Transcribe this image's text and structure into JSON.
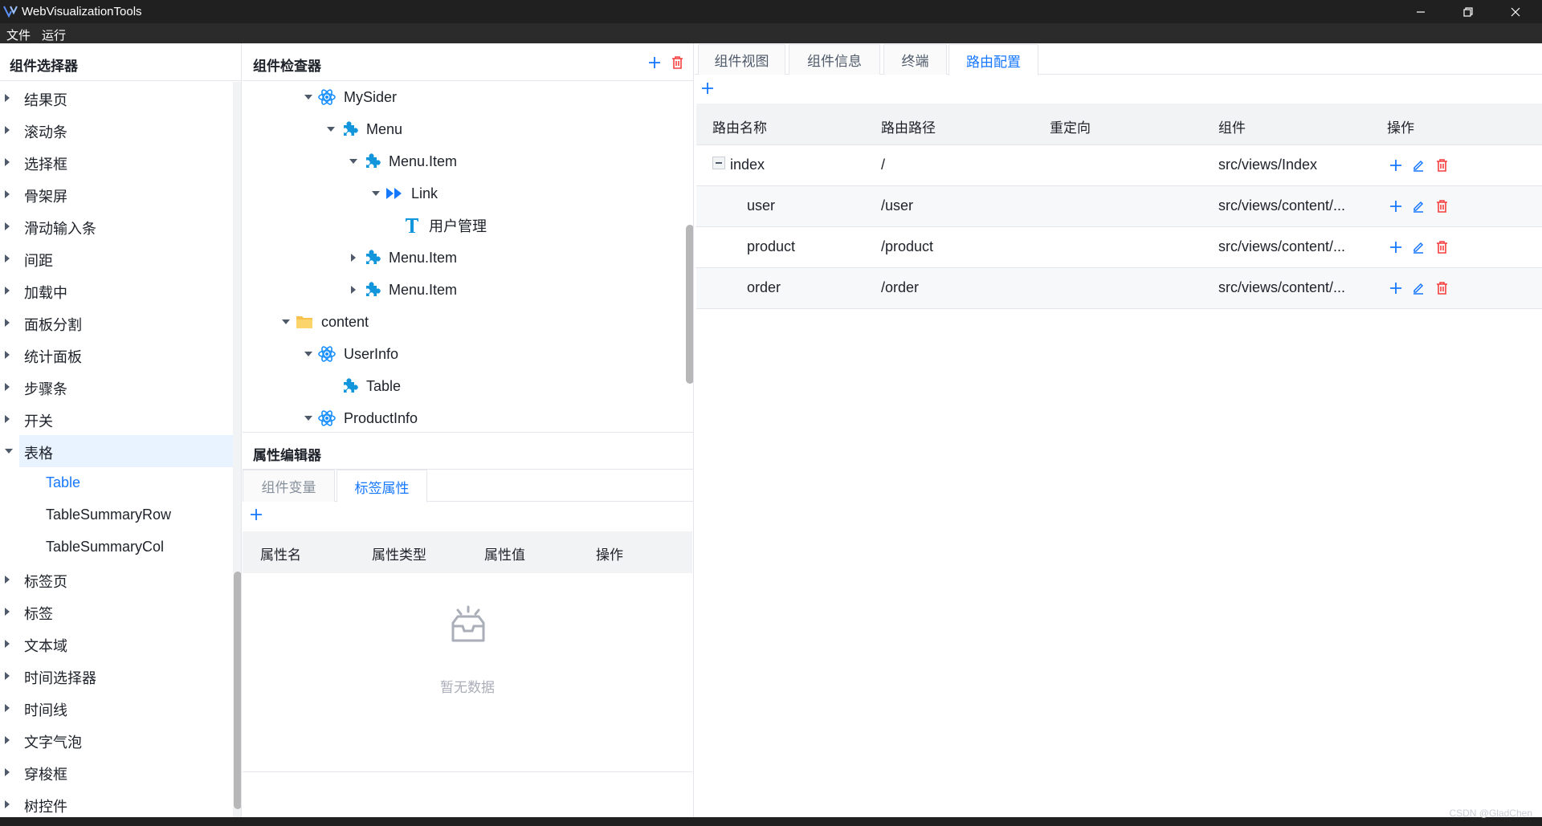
{
  "window": {
    "title": "WebVisualizationTools"
  },
  "menu": [
    "文件",
    "运行"
  ],
  "left": {
    "title": "组件选择器",
    "items": [
      {
        "label": "结果页",
        "state": "collapsed"
      },
      {
        "label": "滚动条",
        "state": "collapsed"
      },
      {
        "label": "选择框",
        "state": "collapsed"
      },
      {
        "label": "骨架屏",
        "state": "collapsed"
      },
      {
        "label": "滑动输入条",
        "state": "collapsed"
      },
      {
        "label": "间距",
        "state": "collapsed"
      },
      {
        "label": "加载中",
        "state": "collapsed"
      },
      {
        "label": "面板分割",
        "state": "collapsed"
      },
      {
        "label": "统计面板",
        "state": "collapsed"
      },
      {
        "label": "步骤条",
        "state": "collapsed"
      },
      {
        "label": "开关",
        "state": "collapsed"
      },
      {
        "label": "表格",
        "state": "expanded"
      },
      {
        "label": "Table",
        "state": "child-selected"
      },
      {
        "label": "TableSummaryRow",
        "state": "child"
      },
      {
        "label": "TableSummaryCol",
        "state": "child"
      },
      {
        "label": "标签页",
        "state": "collapsed"
      },
      {
        "label": "标签",
        "state": "collapsed"
      },
      {
        "label": "文本域",
        "state": "collapsed"
      },
      {
        "label": "时间选择器",
        "state": "collapsed"
      },
      {
        "label": "时间线",
        "state": "collapsed"
      },
      {
        "label": "文字气泡",
        "state": "collapsed"
      },
      {
        "label": "穿梭框",
        "state": "collapsed"
      },
      {
        "label": "树控件",
        "state": "collapsed"
      }
    ]
  },
  "inspector": {
    "title": "组件检查器",
    "nodes": [
      {
        "label": "MySider",
        "icon": "react-icon",
        "caret": "down"
      },
      {
        "label": "Menu",
        "icon": "puzzle-icon",
        "caret": "down"
      },
      {
        "label": "Menu.Item",
        "icon": "puzzle-icon",
        "caret": "down"
      },
      {
        "label": "Link",
        "icon": "forward-icon",
        "caret": "down"
      },
      {
        "label": "用户管理",
        "icon": "text-icon",
        "caret": "none"
      },
      {
        "label": "Menu.Item",
        "icon": "puzzle-icon",
        "caret": "right"
      },
      {
        "label": "Menu.Item",
        "icon": "puzzle-icon",
        "caret": "right"
      },
      {
        "label": "content",
        "icon": "folder-icon",
        "caret": "down"
      },
      {
        "label": "UserInfo",
        "icon": "react-icon",
        "caret": "down"
      },
      {
        "label": "Table",
        "icon": "puzzle-icon",
        "caret": "none"
      },
      {
        "label": "ProductInfo",
        "icon": "react-icon",
        "caret": "down"
      }
    ]
  },
  "props": {
    "title": "属性编辑器",
    "tabs": [
      "组件变量",
      "标签属性"
    ],
    "columns": [
      "属性名",
      "属性类型",
      "属性值",
      "操作"
    ],
    "empty_text": "暂无数据"
  },
  "right": {
    "tabs": [
      "组件视图",
      "组件信息",
      "终端",
      "路由配置"
    ],
    "columns": [
      "路由名称",
      "路由路径",
      "重定向",
      "组件",
      "操作"
    ],
    "rows": [
      {
        "name": "index",
        "path": "/",
        "redirect": "",
        "component": "src/views/Index"
      },
      {
        "name": "user",
        "path": "/user",
        "redirect": "",
        "component": "src/views/content/..."
      },
      {
        "name": "product",
        "path": "/product",
        "redirect": "",
        "component": "src/views/content/..."
      },
      {
        "name": "order",
        "path": "/order",
        "redirect": "",
        "component": "src/views/content/..."
      }
    ]
  },
  "watermark": "CSDN @GladChen",
  "colors": {
    "accent": "#1677ff",
    "danger": "#f53f3f",
    "titlebar": "#202020",
    "menubar": "#2b2b2b",
    "react": "#1890ff"
  }
}
